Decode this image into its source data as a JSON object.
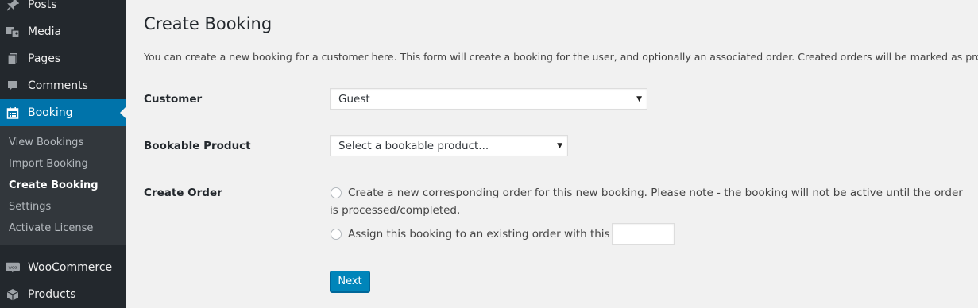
{
  "sidebar": {
    "menu": [
      {
        "label": "Posts",
        "icon": "pin-icon"
      },
      {
        "label": "Media",
        "icon": "media-icon"
      },
      {
        "label": "Pages",
        "icon": "pages-icon"
      },
      {
        "label": "Comments",
        "icon": "comment-icon"
      },
      {
        "label": "Booking",
        "icon": "calendar-icon"
      },
      {
        "label": "WooCommerce",
        "icon": "woocommerce-icon"
      },
      {
        "label": "Products",
        "icon": "box-icon"
      }
    ],
    "submenu": [
      {
        "label": "View Bookings"
      },
      {
        "label": "Import Booking"
      },
      {
        "label": "Create Booking"
      },
      {
        "label": "Settings"
      },
      {
        "label": "Activate License"
      }
    ],
    "woo_badge": "woo"
  },
  "main": {
    "title": "Create Booking",
    "intro": "You can create a new booking for a customer here. This form will create a booking for the user, and optionally an associated order. Created orders will be marked as processing.",
    "customer": {
      "label": "Customer",
      "value": "Guest"
    },
    "product": {
      "label": "Bookable Product",
      "value": "Select a bookable product..."
    },
    "order": {
      "label": "Create Order",
      "option_new": "Create a new corresponding order for this new booking. Please note - the booking will not be active until the order is processed/completed.",
      "option_existing": "Assign this booking to an existing order with this ID:",
      "existing_id": ""
    },
    "next_label": "Next"
  },
  "colors": {
    "sidebar_bg": "#23282d",
    "submenu_bg": "#32373c",
    "active": "#0073aa",
    "button": "#0085ba",
    "page_bg": "#f1f1f1"
  }
}
